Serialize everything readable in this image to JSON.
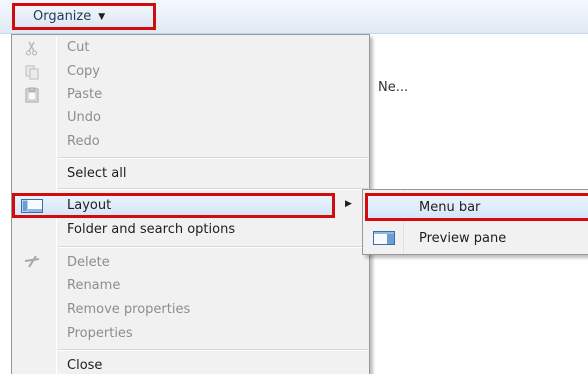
{
  "toolbar": {
    "organize_label": "Organize"
  },
  "background": {
    "folder_text": "Ne..."
  },
  "menu": {
    "items": [
      {
        "label": "Cut",
        "disabled": true
      },
      {
        "label": "Copy",
        "disabled": true
      },
      {
        "label": "Paste",
        "disabled": true
      },
      {
        "label": "Undo",
        "disabled": true
      },
      {
        "label": "Redo",
        "disabled": true
      },
      {
        "label": "Select all",
        "disabled": false
      },
      {
        "label": "Layout",
        "disabled": false
      },
      {
        "label": "Folder and search options",
        "disabled": false
      },
      {
        "label": "Delete",
        "disabled": true
      },
      {
        "label": "Rename",
        "disabled": true
      },
      {
        "label": "Remove properties",
        "disabled": true
      },
      {
        "label": "Properties",
        "disabled": true
      },
      {
        "label": "Close",
        "disabled": false
      }
    ]
  },
  "submenu": {
    "items": [
      {
        "label": "Menu bar"
      },
      {
        "label": "Preview pane"
      }
    ]
  },
  "colors": {
    "highlight": "#d20c0c",
    "hover": "#d5e6fa"
  }
}
